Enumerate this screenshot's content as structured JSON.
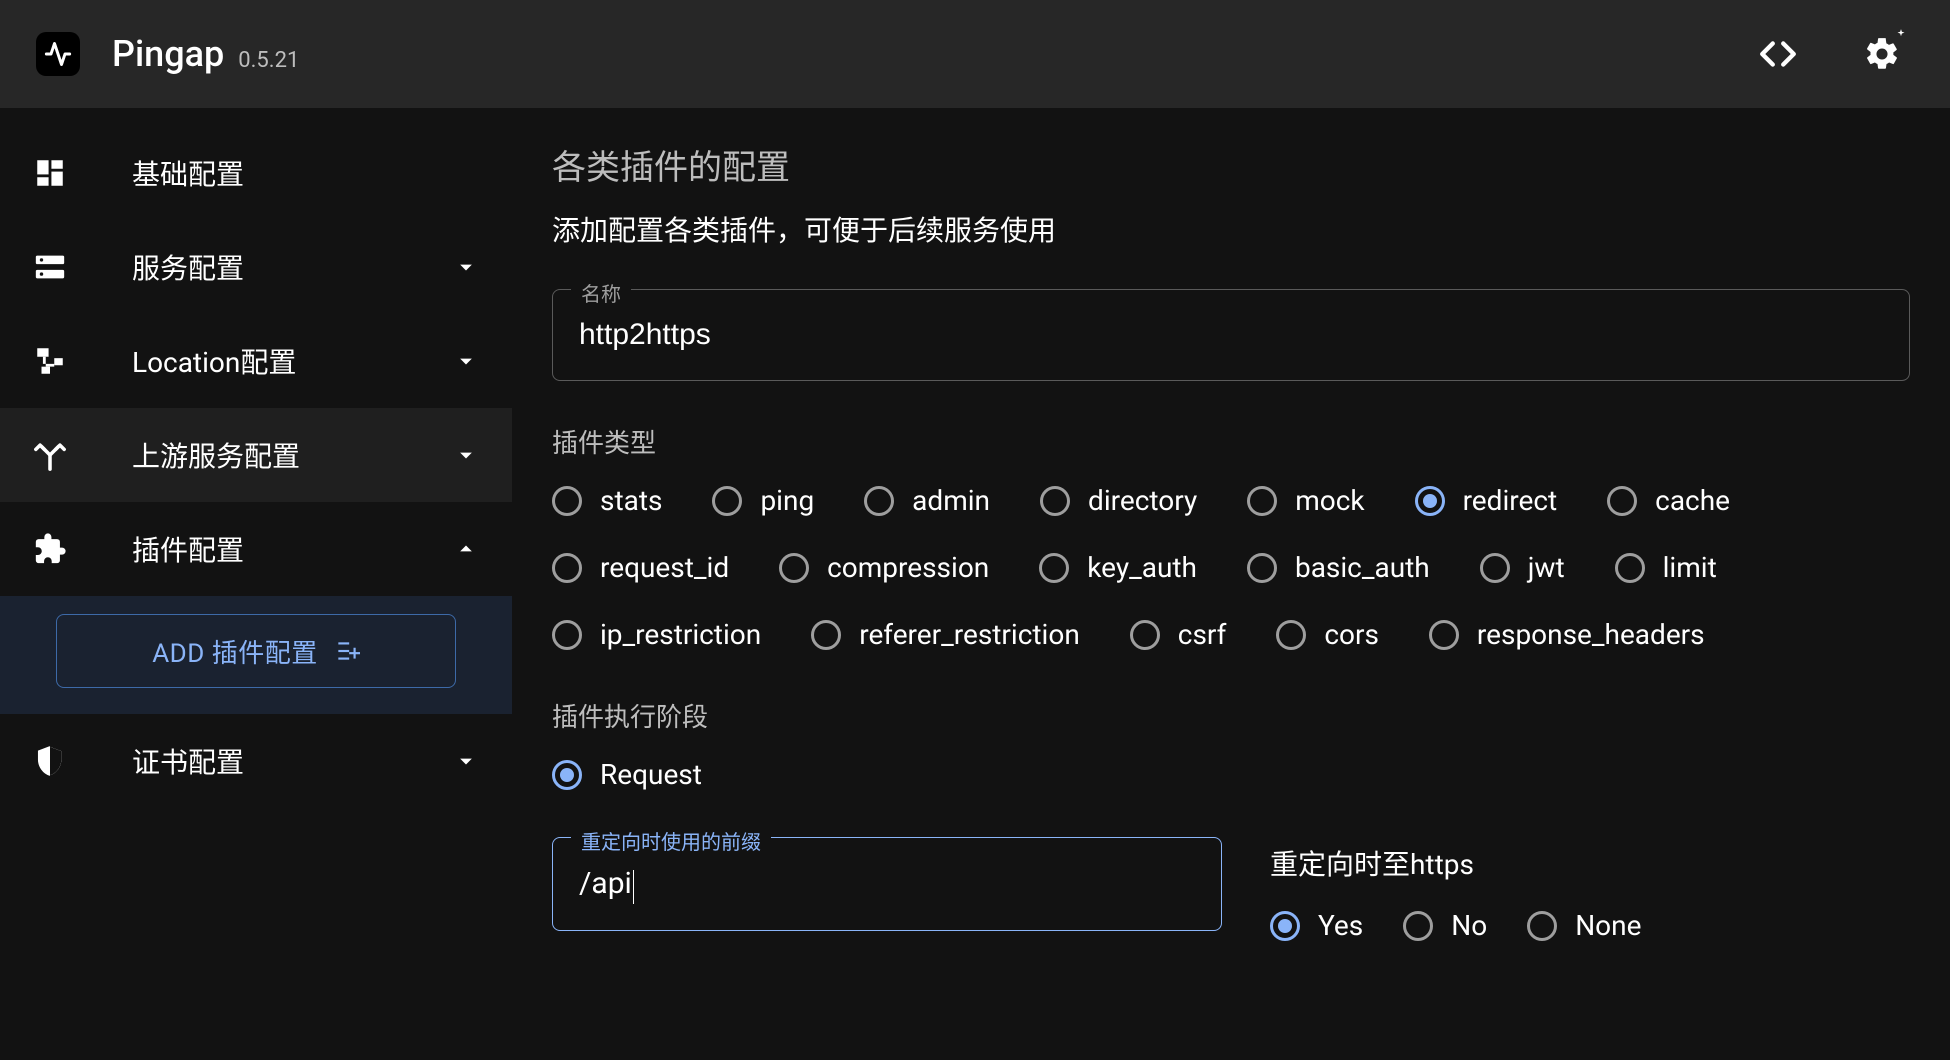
{
  "header": {
    "brand": "Pingap",
    "version": "0.5.21"
  },
  "sidebar": {
    "items": [
      {
        "label": "基础配置",
        "expandable": false
      },
      {
        "label": "服务配置",
        "expandable": true
      },
      {
        "label": "Location配置",
        "expandable": true
      },
      {
        "label": "上游服务配置",
        "expandable": true
      },
      {
        "label": "插件配置",
        "expandable": true,
        "expanded": true
      },
      {
        "label": "证书配置",
        "expandable": true
      }
    ],
    "add_button": "ADD 插件配置"
  },
  "main": {
    "title": "各类插件的配置",
    "description": "添加配置各类插件，可便于后续服务使用",
    "name_field": {
      "legend": "名称",
      "value": "http2https"
    },
    "type_section": {
      "label": "插件类型",
      "options": [
        "stats",
        "ping",
        "admin",
        "directory",
        "mock",
        "redirect",
        "cache",
        "request_id",
        "compression",
        "key_auth",
        "basic_auth",
        "jwt",
        "limit",
        "ip_restriction",
        "referer_restriction",
        "csrf",
        "cors",
        "response_headers"
      ],
      "selected": "redirect"
    },
    "stage_section": {
      "label": "插件执行阶段",
      "options": [
        "Request"
      ],
      "selected": "Request"
    },
    "prefix_field": {
      "legend": "重定向时使用的前缀",
      "value": "/api"
    },
    "https_section": {
      "label": "重定向时至https",
      "options": [
        "Yes",
        "No",
        "None"
      ],
      "selected": "Yes"
    }
  }
}
